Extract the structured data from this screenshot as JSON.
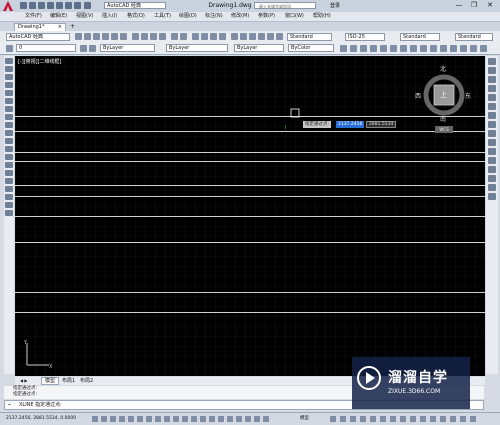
{
  "app": {
    "workspace": "AutoCAD 经典",
    "document_title": "Drawing1.dwg",
    "search_placeholder": "键入关键字或短语",
    "login": "登录",
    "window_buttons": [
      "—",
      "❐",
      "✕"
    ]
  },
  "menu": [
    "文件(F)",
    "编辑(E)",
    "视图(V)",
    "插入(I)",
    "格式(O)",
    "工具(T)",
    "绘图(D)",
    "标注(N)",
    "修改(M)",
    "参数(P)",
    "窗口(W)",
    "帮助(H)"
  ],
  "file_tab": {
    "label": "Drawing1*",
    "close": "×"
  },
  "toolbar1": {
    "workspace": "AutoCAD 经典",
    "text_style": "Standard",
    "dim_style": "ISO-25",
    "table_style": "Standard",
    "mleader_style": "Standard"
  },
  "toolbar2": {
    "layer": "0",
    "color": "ByLayer",
    "linetype": "ByLayer",
    "lineweight": "ByLayer",
    "plotstyle": "ByColor"
  },
  "viewport": {
    "label": "[-][俯视][二维线框]"
  },
  "viewcube": {
    "north": "北",
    "south": "南",
    "east": "东",
    "west": "西",
    "top": "上",
    "wcs": "WCS"
  },
  "dynamic_input": {
    "prompt": "指定通过点:",
    "x": "2137.2456",
    "y": "2881.5534"
  },
  "layout_tabs": [
    "模型",
    "布局1",
    "布局2"
  ],
  "command": {
    "history": [
      "指定通过点:",
      "指定通过点:"
    ],
    "current": "XLINE 指定通过点:"
  },
  "status": {
    "coords": "2137.2456, 2881.5534, 0.0000",
    "mode": "模型"
  },
  "watermark": {
    "brand": "溜溜自学",
    "url": "ZIXUE.3D66.COM"
  },
  "colors": {
    "canvas": "#000000",
    "accent": "#2a6fd8",
    "title_bg": "#c9d3e0"
  }
}
